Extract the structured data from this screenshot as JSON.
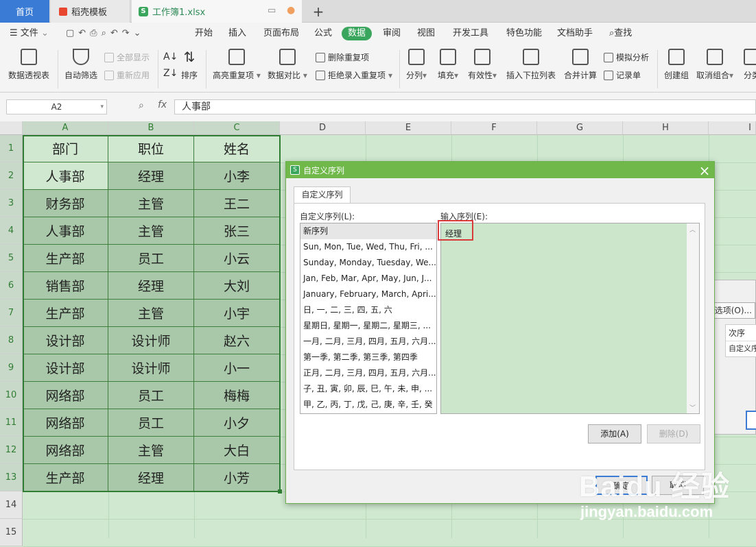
{
  "tabs": {
    "home": "首页",
    "template": "稻壳模板",
    "workbook": "工作簿1.xlsx",
    "add": "+"
  },
  "menu": {
    "file": "文件",
    "items": [
      "开始",
      "插入",
      "页面布局",
      "公式",
      "数据",
      "审阅",
      "视图",
      "开发工具",
      "特色功能",
      "文档助手"
    ],
    "search": "查找"
  },
  "ribbon": {
    "pivot": "数据透视表",
    "autofilter": "自动筛选",
    "show_all": "全部显示",
    "reapply": "重新应用",
    "sort": "排序",
    "highlight_dup": "高亮重复项",
    "compare": "数据对比",
    "remove_dup": "删除重复项",
    "reject_dup": "拒绝录入重复项",
    "split": "分列",
    "fill": "填充",
    "validity": "有效性",
    "insert_dropdown": "插入下拉列表",
    "consolidate": "合并计算",
    "what_if": "模拟分析",
    "record_form": "记录单",
    "group": "创建组",
    "ungroup": "取消组合",
    "subtotal": "分类"
  },
  "formula": {
    "cell_ref": "A2",
    "fx": "fx",
    "value": "人事部"
  },
  "sheet": {
    "columns": [
      "A",
      "B",
      "C",
      "D",
      "E",
      "F",
      "G",
      "H",
      "I"
    ],
    "rows": [
      "1",
      "2",
      "3",
      "4",
      "5",
      "6",
      "7",
      "8",
      "9",
      "10",
      "11",
      "12",
      "13",
      "14",
      "15"
    ],
    "header": [
      "部门",
      "职位",
      "姓名"
    ],
    "data": [
      [
        "人事部",
        "经理",
        "小李"
      ],
      [
        "财务部",
        "主管",
        "王二"
      ],
      [
        "人事部",
        "主管",
        "张三"
      ],
      [
        "生产部",
        "员工",
        "小云"
      ],
      [
        "销售部",
        "经理",
        "大刘"
      ],
      [
        "生产部",
        "主管",
        "小宇"
      ],
      [
        "设计部",
        "设计师",
        "赵六"
      ],
      [
        "设计部",
        "设计师",
        "小一"
      ],
      [
        "网络部",
        "员工",
        "梅梅"
      ],
      [
        "网络部",
        "员工",
        "小夕"
      ],
      [
        "网络部",
        "主管",
        "大白"
      ],
      [
        "生产部",
        "经理",
        "小芳"
      ]
    ]
  },
  "background_dialog": {
    "options_button": "选项(O)...",
    "order_header": "次序",
    "order_value": "自定义序"
  },
  "dialog": {
    "title": "自定义序列",
    "tab": "自定义序列",
    "list_label": "自定义序列(L):",
    "entry_label": "输入序列(E):",
    "lists": [
      "新序列",
      "Sun, Mon, Tue, Wed, Thu, Fri, ...",
      "Sunday, Monday, Tuesday, We...",
      "Jan, Feb, Mar, Apr, May, Jun, J...",
      "January, February, March, Apri...",
      "日, 一, 二, 三, 四, 五, 六",
      "星期日, 星期一, 星期二, 星期三, ...",
      "一月, 二月, 三月, 四月, 五月, 六月...",
      "第一季, 第二季, 第三季, 第四季",
      "正月, 二月, 三月, 四月, 五月, 六月...",
      "子, 丑, 寅, 卯, 辰, 巳, 午, 未, 申, ...",
      "甲, 乙, 丙, 丁, 戊, 己, 庚, 辛, 壬, 癸"
    ],
    "entry_value": "经理",
    "add_button": "添加(A)",
    "delete_button": "删除(D)",
    "ok_button": "确定",
    "cancel_button": "取消"
  },
  "watermark": {
    "brand": "Baidu 经验",
    "url": "jingyan.baidu.com"
  }
}
